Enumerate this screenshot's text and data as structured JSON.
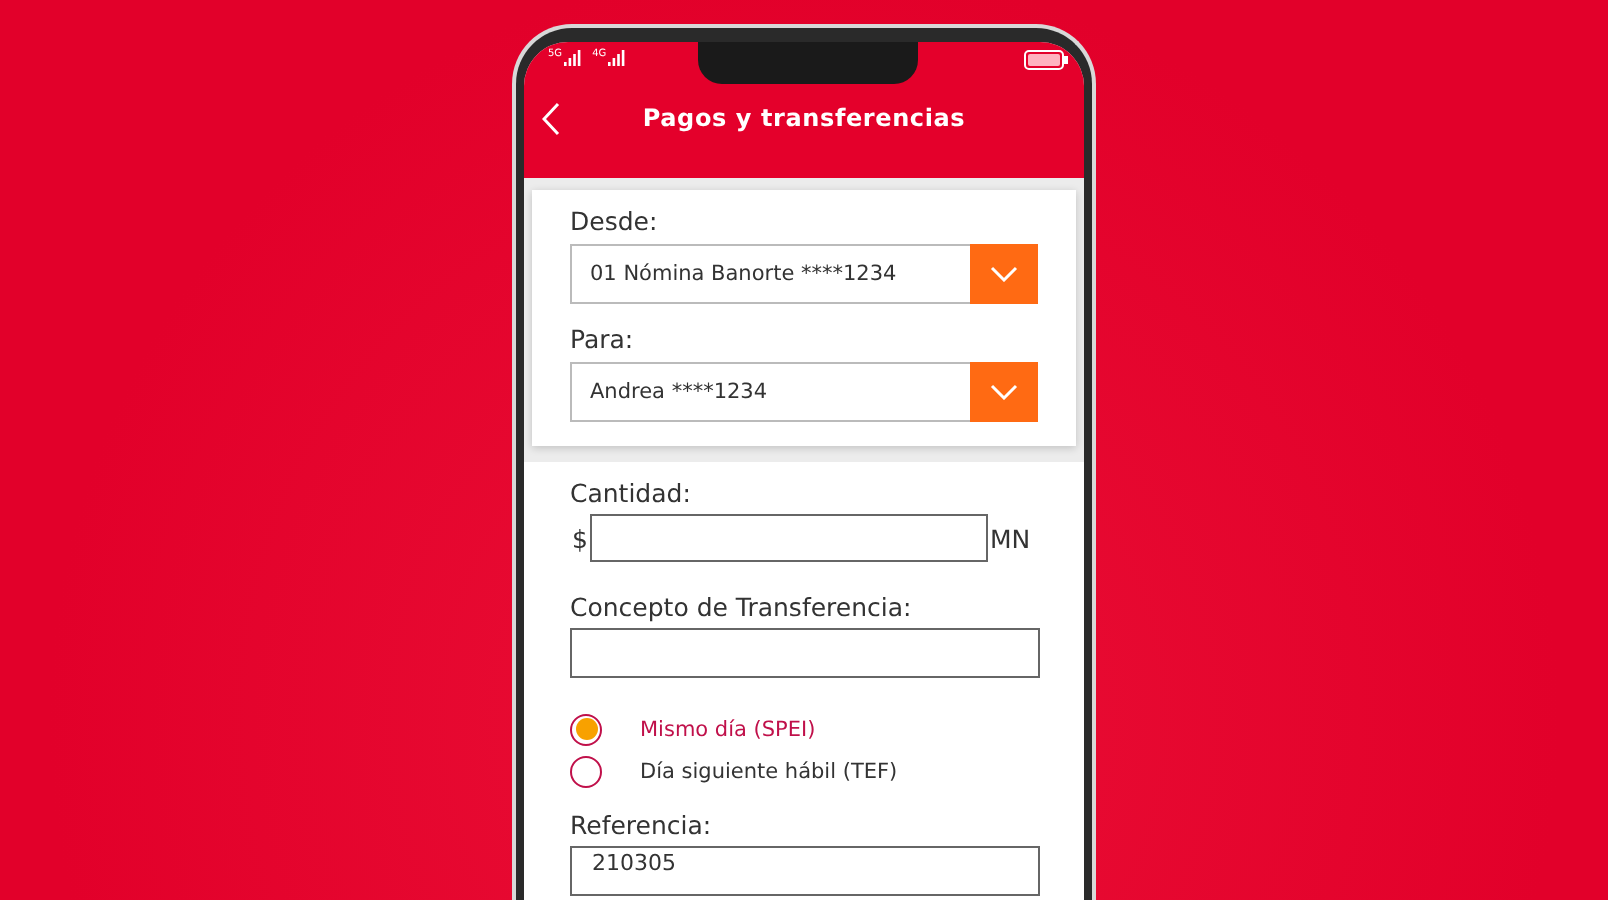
{
  "status_bar": {
    "network_1": "5G",
    "network_2": "4G"
  },
  "header": {
    "title": "Pagos y transferencias"
  },
  "account_card": {
    "fields": [
      {
        "label": "Desde:",
        "value": "01 Nómina Banorte ****1234"
      },
      {
        "label": "Para:",
        "value": "Andrea ****1234"
      }
    ]
  },
  "form": {
    "amount": {
      "label": "Cantidad:",
      "prefix": "$",
      "suffix": "MN"
    },
    "concept": {
      "label": "Concepto de Transferencia:"
    },
    "options": [
      {
        "label": "Mismo día (SPEI)",
        "selected": true
      },
      {
        "label": "Día siguiente hábil (TEF)",
        "selected": false
      }
    ],
    "reference": {
      "label": "Referencia:",
      "value": "210305"
    }
  }
}
